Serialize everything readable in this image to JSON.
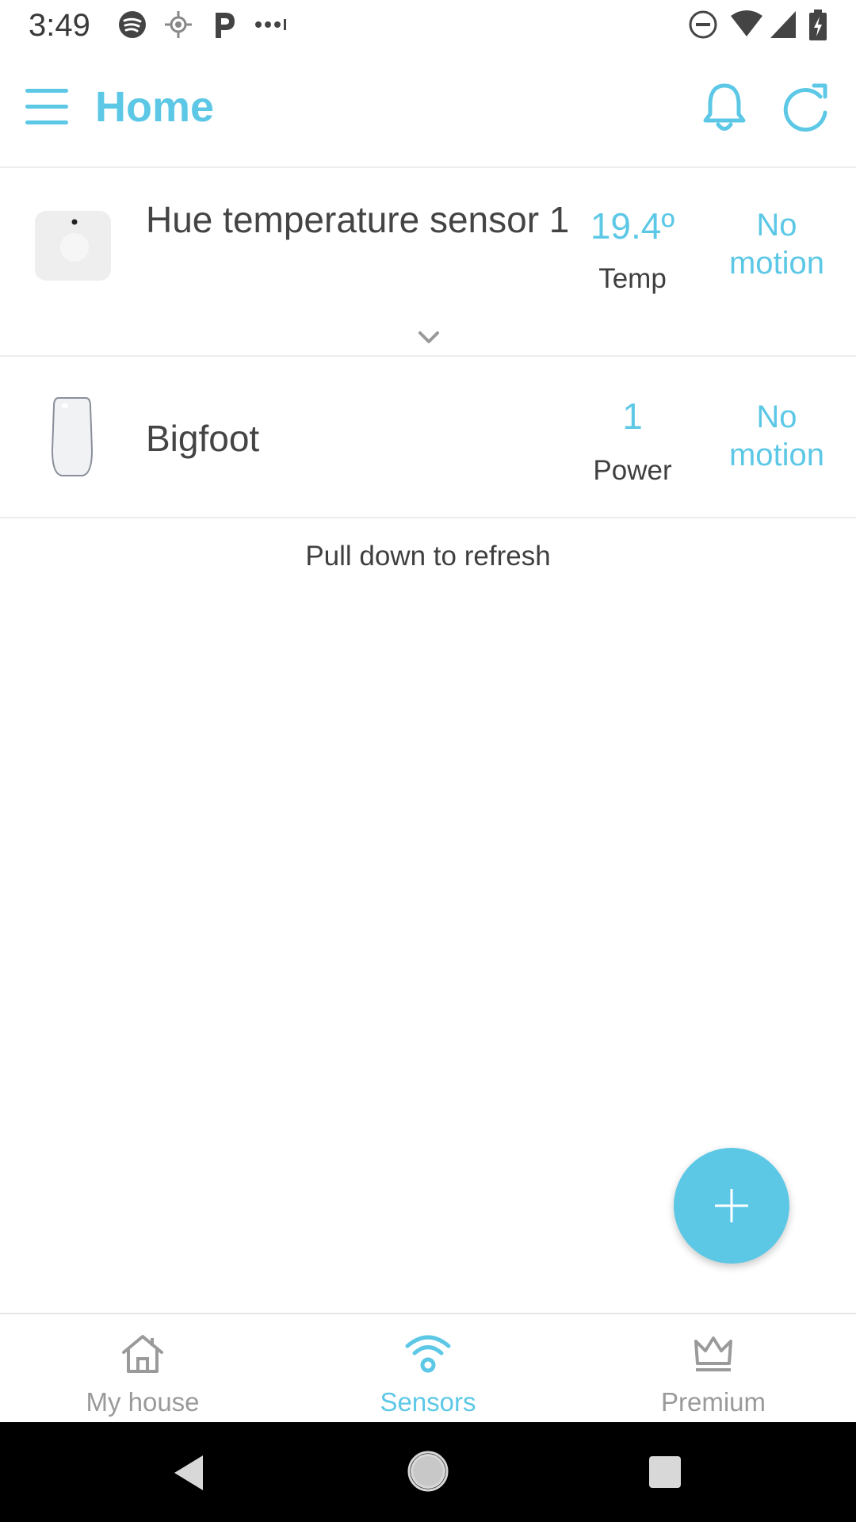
{
  "colors": {
    "accent": "#5cc8e6",
    "text_dark": "#444444",
    "text_muted": "#9a9a9a",
    "divider": "#ededed",
    "system_nav_bg": "#000000"
  },
  "status_bar": {
    "time": "3:49",
    "left_icons": [
      "spotify-icon",
      "location-icon",
      "p-app-icon",
      "more-notifications-icon"
    ],
    "right_icons": [
      "do-not-disturb-icon",
      "wifi-icon",
      "cell-signal-icon",
      "battery-charging-icon"
    ]
  },
  "app_bar": {
    "title": "Home",
    "menu_icon": "hamburger-menu-icon",
    "actions": [
      "bell-icon",
      "refresh-icon"
    ]
  },
  "sensors": [
    {
      "name": "Hue temperature sensor 1",
      "metric_value": "19.4º",
      "metric_label": "Temp",
      "motion": "No motion",
      "thumbnail": "hue-sensor-thumbnail",
      "expand_icon": "chevron-down-icon"
    },
    {
      "name": "Bigfoot",
      "metric_value": "1",
      "metric_label": "Power",
      "motion": "No motion",
      "thumbnail": "bigfoot-sensor-thumbnail"
    }
  ],
  "pull_hint": "Pull down to refresh",
  "fab": {
    "icon": "plus-icon"
  },
  "bottom_nav": {
    "items": [
      {
        "label": "My house",
        "icon": "house-icon",
        "active": false
      },
      {
        "label": "Sensors",
        "icon": "wifi-sensor-icon",
        "active": true
      },
      {
        "label": "Premium",
        "icon": "crown-icon",
        "active": false
      }
    ]
  },
  "system_nav": {
    "buttons": [
      "back-icon",
      "home-circle-icon",
      "recents-square-icon"
    ]
  }
}
